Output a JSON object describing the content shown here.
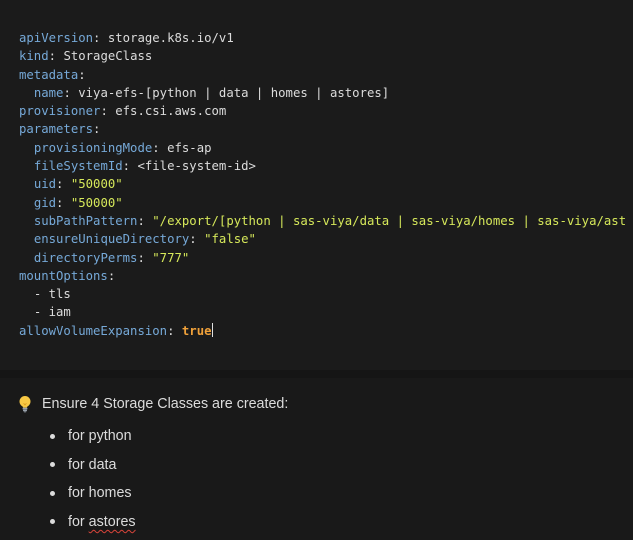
{
  "code": {
    "lines": [
      {
        "key": "apiVersion",
        "sep": ": ",
        "val": "storage.k8s.io/v1"
      },
      {
        "key": "kind",
        "sep": ": ",
        "val": "StorageClass"
      },
      {
        "key": "metadata",
        "sep": ":",
        "val": ""
      },
      {
        "indent": "  ",
        "key": "name",
        "sep": ": ",
        "val": "viya-efs-[python | data | homes | astores]"
      },
      {
        "key": "provisioner",
        "sep": ": ",
        "val": "efs.csi.aws.com"
      },
      {
        "key": "parameters",
        "sep": ":",
        "val": ""
      },
      {
        "indent": "  ",
        "key": "provisioningMode",
        "sep": ": ",
        "val": "efs-ap"
      },
      {
        "indent": "  ",
        "key": "fileSystemId",
        "sep": ": ",
        "val": "<file-system-id>"
      },
      {
        "indent": "  ",
        "key": "uid",
        "sep": ": ",
        "str": "\"50000\""
      },
      {
        "indent": "  ",
        "key": "gid",
        "sep": ": ",
        "str": "\"50000\""
      },
      {
        "indent": "  ",
        "key": "subPathPattern",
        "sep": ": ",
        "str": "\"/export/[python | sas-viya/data | sas-viya/homes | sas-viya/ast"
      },
      {
        "indent": "  ",
        "key": "ensureUniqueDirectory",
        "sep": ": ",
        "str": "\"false\""
      },
      {
        "indent": "  ",
        "key": "directoryPerms",
        "sep": ": ",
        "str": "\"777\""
      },
      {
        "key": "mountOptions",
        "sep": ":",
        "val": ""
      },
      {
        "indent": "  ",
        "val": "- tls"
      },
      {
        "indent": "  ",
        "val": "- iam"
      },
      {
        "key": "allowVolumeExpansion",
        "sep": ": ",
        "bool": "true",
        "cursor": true
      }
    ]
  },
  "callout": {
    "icon": "lightbulb-icon",
    "title": "Ensure 4 Storage Classes are created:",
    "items": [
      {
        "label": "for python"
      },
      {
        "label": "for data"
      },
      {
        "label": "for homes"
      },
      {
        "label": "for astores",
        "spellcheck": true
      }
    ]
  },
  "colors": {
    "background": "#191919",
    "key": "#76a9d8",
    "string": "#d6e85a",
    "boolean": "#f0a13a",
    "text": "#dcdcdc",
    "spellcheck": "#d9443a"
  }
}
